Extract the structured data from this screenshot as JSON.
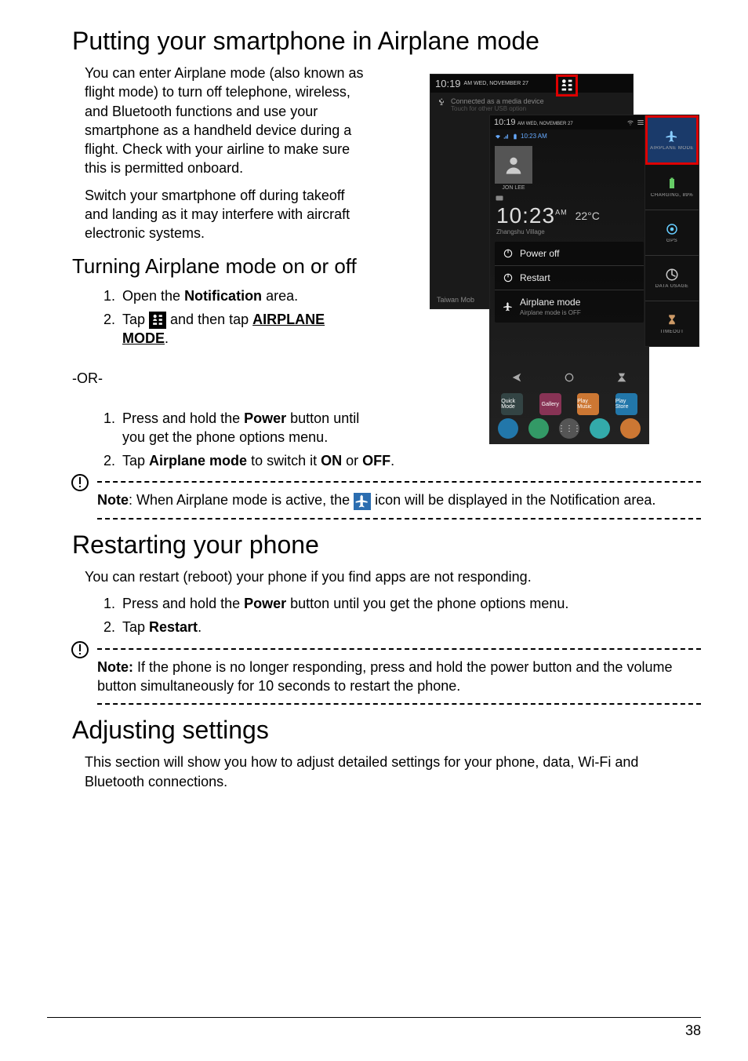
{
  "page_number": "38",
  "sections": {
    "airplane": {
      "title": "Putting your smartphone in Airplane mode",
      "para1": "You can enter Airplane mode (also known as flight mode) to turn off telephone, wireless, and Bluetooth functions and use your smartphone as a handheld device during a flight. Check with your airline to make sure this is permitted onboard.",
      "para2": "Switch your smartphone off during takeoff and landing as it may interfere with aircraft electronic systems.",
      "sub_title": "Turning Airplane mode on or off",
      "step1_a": "Open the ",
      "step1_b": "Notification",
      "step1_c": " area.",
      "step2_a": "Tap ",
      "step2_b": " and then tap ",
      "step2_c": "AIRPLANE MODE",
      "step2_d": ".",
      "or": "-OR-",
      "alt_step1_a": "Press and hold the ",
      "alt_step1_b": "Power",
      "alt_step1_c": " button until you get the phone options menu.",
      "alt_step2_a": "Tap ",
      "alt_step2_b": "Airplane mode",
      "alt_step2_c": " to switch it ",
      "alt_step2_d": "ON",
      "alt_step2_e": " or ",
      "alt_step2_f": "OFF",
      "alt_step2_g": ".",
      "note_a": "Note",
      "note_b": ": When Airplane mode is active, the ",
      "note_c": " icon will be displayed in the Notification area."
    },
    "restart": {
      "title": "Restarting your phone",
      "para": "You can restart (reboot) your phone if you find apps are not responding.",
      "step1_a": "Press and hold the ",
      "step1_b": "Power",
      "step1_c": " button until you get the phone options menu.",
      "step2_a": "Tap ",
      "step2_b": "Restart",
      "step2_c": ".",
      "note_a": "Note:",
      "note_b": " If the phone is no longer responding, press and hold the power button and the volume button simultaneously for 10 seconds to restart the phone."
    },
    "adjust": {
      "title": "Adjusting settings",
      "para": "This section will show you how to adjust detailed settings for your phone, data, Wi-Fi and Bluetooth connections."
    }
  },
  "screenshot": {
    "back_time": "10:19",
    "back_date_suffix": "AM WED, NOVEMBER 27",
    "usb_line1": "Connected as a media device",
    "usb_line2": "Touch for other USB option",
    "carrier": "Taiwan Mob",
    "mid_time": "10:19",
    "mid_date_suffix": "AM WED, NOVEMBER 27",
    "alarm_time": "10:23 AM",
    "user_name": "JON LEE",
    "bigtime": "10:23",
    "bigtime_suffix": "AM",
    "village": "Zhangshu Village",
    "temp": "22°C",
    "menu": {
      "power_off": "Power off",
      "restart": "Restart",
      "airplane": "Airplane mode",
      "airplane_sub": "Airplane mode is OFF"
    },
    "quick_tiles": {
      "airplane": "AIRPLANE MODE",
      "charging": "CHARGING, 89%",
      "gps": "GPS",
      "data": "DATA USAGE",
      "timeout": "TIMEOUT"
    },
    "dock": {
      "a": "Quick Mode",
      "b": "Gallery",
      "c": "Play Music",
      "d": "Play Store"
    }
  }
}
